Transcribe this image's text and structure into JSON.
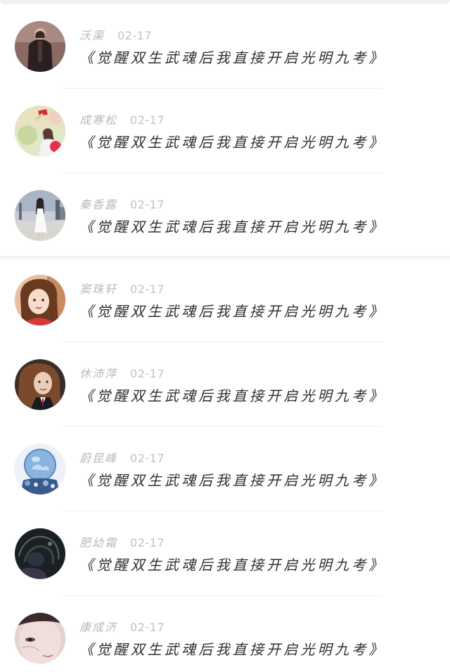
{
  "comments": [
    {
      "user": "沃渠",
      "date": "02-17",
      "text": "《觉醒双生武魂后我直接开启光明九考》",
      "avatar": "avatar-man-dark-jacket"
    },
    {
      "user": "成寒松",
      "date": "02-17",
      "text": "《觉醒双生武魂后我直接开启光明九考》",
      "avatar": "avatar-girl-flowers"
    },
    {
      "user": "秦香露",
      "date": "02-17",
      "text": "《觉醒双生武魂后我直接开启光明九考》",
      "avatar": "avatar-girl-street"
    },
    {
      "user": "窦珠轩",
      "date": "02-17",
      "text": "《觉醒双生武魂后我直接开启光明九考》",
      "avatar": "avatar-girl-portrait"
    },
    {
      "user": "休沛萍",
      "date": "02-17",
      "text": "《觉醒双生武魂后我直接开启光明九考》",
      "avatar": "avatar-girl-curly-hair"
    },
    {
      "user": "蔚昆峰",
      "date": "02-17",
      "text": "《觉醒双生武魂后我直接开启光明九考》",
      "avatar": "avatar-crystal-globe"
    },
    {
      "user": "肥幼霜",
      "date": "02-17",
      "text": "《觉醒双生武魂后我直接开启光明九考》",
      "avatar": "avatar-dark-sketch"
    },
    {
      "user": "康成济",
      "date": "02-17",
      "text": "《觉醒双生武魂后我直接开启光明九考》",
      "avatar": "avatar-face-closeup"
    }
  ]
}
